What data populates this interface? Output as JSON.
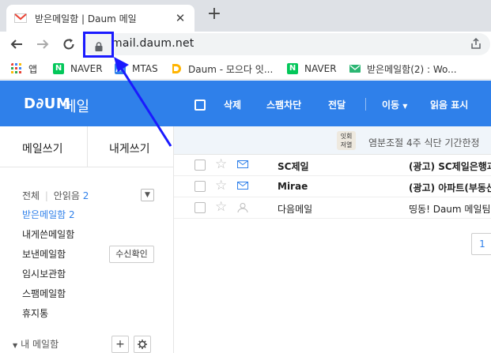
{
  "browser": {
    "tab_title": "받은메일함 | Daum 메일",
    "tab_close": "✕",
    "new_tab": "+",
    "url": "mail.daum.net",
    "bookmarks": [
      {
        "label": "앱",
        "icon": "apps-grid-icon"
      },
      {
        "label": "NAVER",
        "icon": "naver-icon",
        "color": "#03c75a"
      },
      {
        "label": "MTAS",
        "icon": "mtas-icon",
        "color": "#2f80ea"
      },
      {
        "label": "Daum - 모으다 잇...",
        "icon": "daum-icon"
      },
      {
        "label": "NAVER",
        "icon": "naver-icon",
        "color": "#03c75a"
      },
      {
        "label": "받은메일함(2) : Wo...",
        "icon": "mail-icon",
        "color": "#2bb673"
      }
    ]
  },
  "mail": {
    "logo": "D∂UM",
    "logo_sub": "메일",
    "toolbar": {
      "delete": "삭제",
      "block_spam": "스팸차단",
      "forward": "전달",
      "move": "이동",
      "read_mark": "읽음 표시"
    },
    "compose": "메일쓰기",
    "compose_self": "내게쓰기",
    "filter": {
      "all": "전체",
      "unread": "안읽음",
      "unread_count": "2"
    },
    "folders": [
      {
        "label": "받은메일함",
        "count": "2"
      },
      {
        "label": "내게쓴메일함"
      },
      {
        "label": "보낸메일함"
      },
      {
        "label": "임시보관함"
      },
      {
        "label": "스팸메일함"
      },
      {
        "label": "휴지통"
      }
    ],
    "receipt_button": "수신확인",
    "my_folder": "내 메일함",
    "add_folder": "+",
    "ad": {
      "icon_text": "잇회\n저열",
      "text": "염분조절 4주 식단 기간한정"
    },
    "messages": [
      {
        "sender": "SC제일",
        "subject": "(광고) SC제일은행과",
        "unread": true
      },
      {
        "sender": "Mirae",
        "subject": "(광고) 아파트(부동산",
        "unread": true
      },
      {
        "sender": "다음메일",
        "subject": "띵동! Daum 메일팀",
        "unread": false
      }
    ],
    "page": "1"
  },
  "colors": {
    "brand": "#2f80ea",
    "annotation": "#1a1aff"
  }
}
